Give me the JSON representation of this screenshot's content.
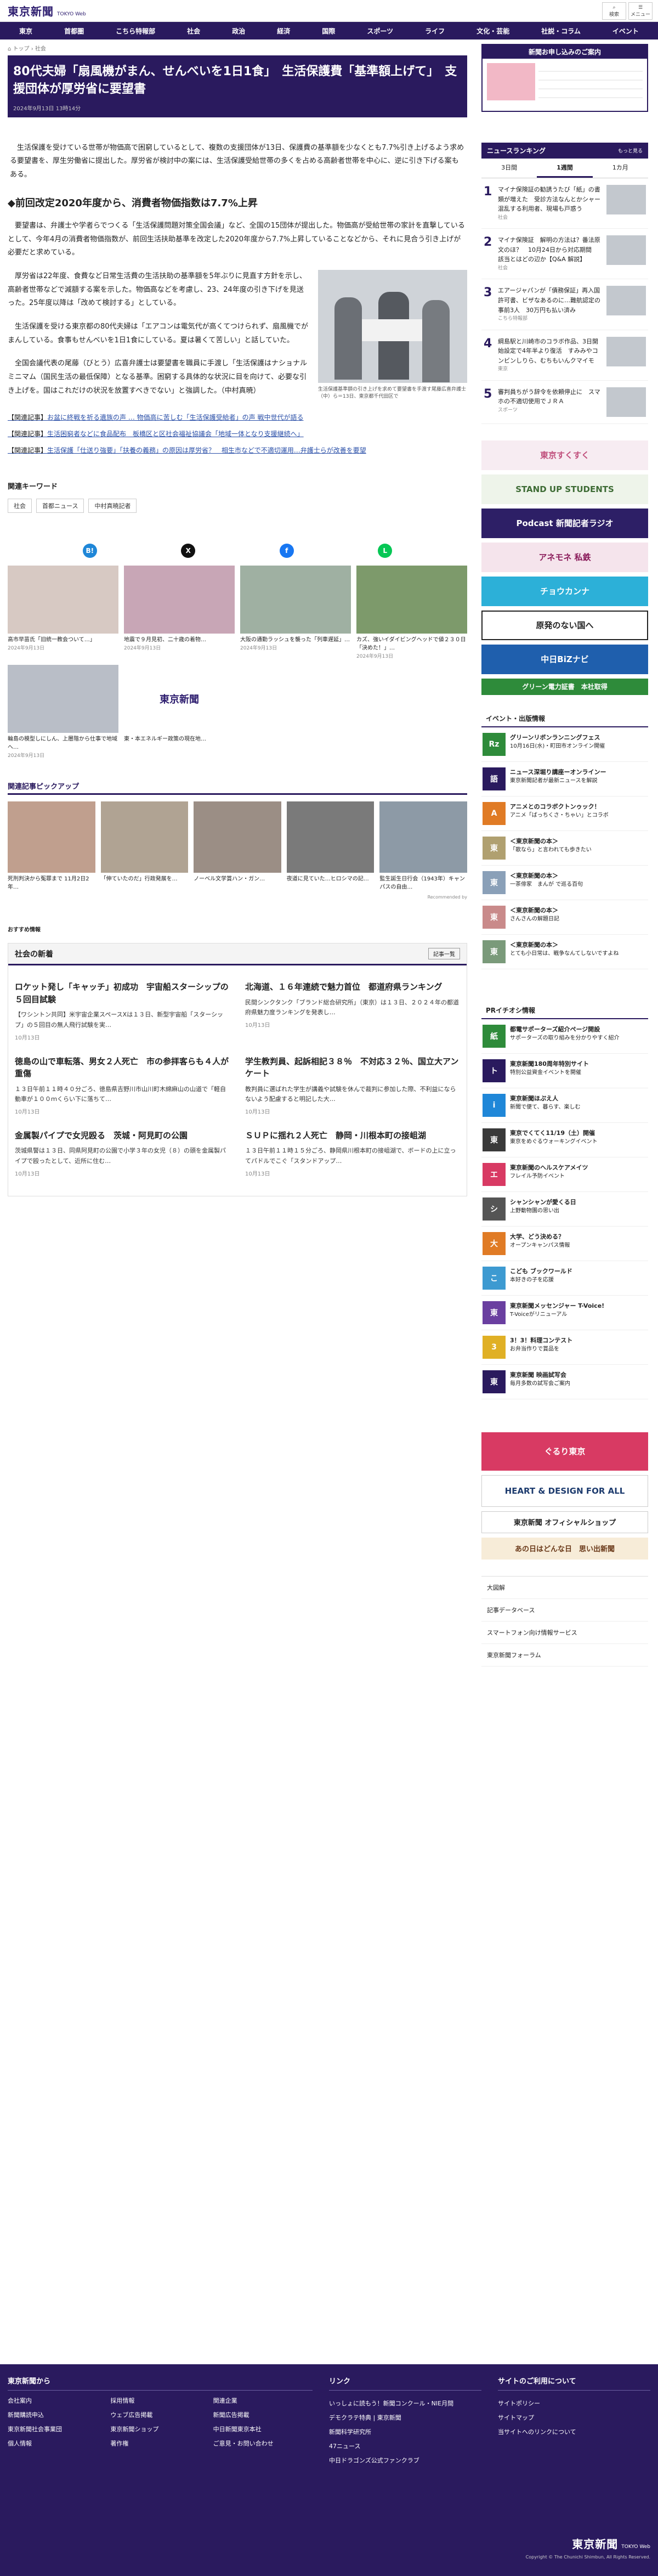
{
  "brand": {
    "jp": "東京新聞",
    "en": "TOKYO Web"
  },
  "top_icons": [
    {
      "label": "検索"
    },
    {
      "label": "メニュー"
    }
  ],
  "nav": [
    "東京",
    "首都圏",
    "こちら特報部",
    "社会",
    "政治",
    "経済",
    "国際",
    "スポーツ",
    "ライフ",
    "文化・芸能",
    "社説・コラム",
    "イベント"
  ],
  "breadcrumb": [
    "トップ",
    "社会"
  ],
  "article": {
    "title": "80代夫婦「扇風機がまん、せんべいを1日1食」　生活保護費「基準額上げて」　支援団体が厚労省に要望書",
    "date": "2024年9月13日 13時14分",
    "lead": "生活保護を受けている世帯が物価高で困窮しているとして、複数の支援団体が13日、保護費の基準額を少なくとも7.7%引き上げるよう求める要望書を、厚生労働省に提出した。厚労省が検討中の案には、生活保護受給世帯の多くを占める高齢者世帯を中心に、逆に引き下げる案もある。",
    "subhead": "◆前回改定2020年度から、消費者物価指数は7.7%上昇",
    "p1": "要望書は、弁護士や学者らでつくる「生活保護問題対策全国会議」など、全国の15団体が提出した。物価高が受給世帯の家計を直撃しているとして、今年4月の消費者物価指数が、前回生活扶助基準を改定した2020年度から7.7%上昇していることなどから、それに見合う引き上げが必要だと求めている。",
    "p2": "厚労省は22年度、食費など日常生活費の生活扶助の基準額を5年ぶりに見直す方針を示し、高齢者世帯などで減額する案を示した。物価高などを考慮し、23、24年度の引き下げを見送った。25年度以降は「改めて検討する」としている。",
    "p3": "生活保護を受ける東京都の80代夫婦は「エアコンは電気代が高くてつけられず、扇風機でがまんしている。食事もせんべいを1日1食にしている。夏は暑くて苦しい」と話していた。",
    "p4": "全国会議代表の尾藤（びとう）広喜弁護士は要望書を職員に手渡し「生活保護はナショナルミニマム（国民生活の最低保障）となる基準。困窮する具体的な状況に目を向けて、必要な引き上げを。国はこれだけの状況を放置すべきでない」と強調した。（中村真暁）",
    "caption": "生活保護基準額の引き上げを求めて要望書を手渡す尾藤広喜弁護士（中）ら＝13日、東京都千代田区で",
    "related": [
      {
        "tag": "【関連記事】",
        "text": "お盆に終戦を祈る遺族の声 … 物価高に苦しむ「生活保護受給者」の声 戦中世代が語る"
      },
      {
        "tag": "【関連記事】",
        "text": "生活困窮者などに食品配布　板橋区と区社会福祉協議会「地域一体となり支援継続へ」"
      },
      {
        "tag": "【関連記事】",
        "text": "生活保護「仕送り強要」「扶養の義務」の原因は厚労省？　相生市などで不適切運用…弁護士らが改善を要望"
      }
    ]
  },
  "keywords": {
    "title": "関連キーワード",
    "items": [
      "社会",
      "首都ニュース",
      "中村真暁記者"
    ]
  },
  "thumbs": [
    {
      "title": "高市早苗氏「旧統一教会ついて…」",
      "date": "2024年9月13日"
    },
    {
      "title": "地震で９月見初、二十歳の着物…",
      "date": "2024年9月13日"
    },
    {
      "title": "大阪の通勤ラッシュを襲った「列車遅延」…",
      "date": "2024年9月13日"
    },
    {
      "title": "カズ、強いイダイビングヘッドで値２３０日「決めた！」…",
      "date": "2024年9月13日"
    },
    {
      "title": "輪島の模型しにしん、上層階から仕事で地域へ…",
      "date": "2024年9月13日"
    },
    {
      "title": "東・本エネルギー政策の現在地…",
      "date": ""
    }
  ],
  "pickup": {
    "title": "関連記事ピックアップ",
    "items": [
      {
        "title": "死刑判決から冤罪まで 11月2日2年…"
      },
      {
        "title": "「伸ていたのだ」行政発展を…"
      },
      {
        "title": "ノーベル文学賞ハン・ガン…"
      },
      {
        "title": "夜道に見ていた…ヒロシマの記…"
      },
      {
        "title": "監生誕生日行会（1943年）キャンパスの自由…"
      }
    ],
    "credit": "Recommended by"
  },
  "recommend": "おすすめ情報",
  "news": {
    "title": "社会の新着",
    "more": "記事一覧",
    "items": [
      {
        "title": "ロケット発し「キャッチ」初成功　宇宙船スターシップの５回目試験",
        "desc": "【ワシントン共同】米宇宙企業スペースXは１３日、新型宇宙船「スターシップ」の５回目の無人飛行試験を実…",
        "date": "10月13日"
      },
      {
        "title": "北海道、１６年連続で魅力首位　都道府県ランキング",
        "desc": "民間シンクタンク「ブランド総合研究所」（東京）は１３日、２０２４年の都道府県魅力度ランキングを発表し…",
        "date": "10月13日"
      },
      {
        "title": "徳島の山で車転落、男女２人死亡　市の参拝客らも４人が重傷",
        "desc": "１３日午前１１時４０分ごろ、徳島県吉野川市山川町木綿麻山の山道で「軽自動車が１００ｍくらい下に落ちて…",
        "date": "10月13日"
      },
      {
        "title": "学生教判員、起訴相記３８％　不対応３２％、国立大アンケート",
        "desc": "教判員に選ばれた学生が講義や試験を休んで裁判に参加した際、不利益にならないよう配慮すると明記した大…",
        "date": "10月13日"
      },
      {
        "title": "金属製パイプで女児殴る　茨城・阿見町の公園",
        "desc": "茨城県警は１３日、同県阿見町の公園で小学３年の女児（８）の頭を金属製パイプで殴ったとして、近所に住む…",
        "date": "10月13日"
      },
      {
        "title": "ＳＵＰに揺れ２人死亡　静岡・川根本町の接岨湖",
        "desc": "１３日午前１１時１５分ごろ、静岡県川根本町の接岨湖で、ボードの上に立ってパドルでこぐ「スタンドアップ…",
        "date": "10月13日"
      }
    ]
  },
  "side": {
    "ad_top": "新聞お申し込みのご案内",
    "ranking": {
      "title": "ニュースランキング",
      "more": "もっと見る",
      "tabs": [
        "3日間",
        "1週間",
        "1カ月"
      ],
      "items": [
        {
          "n": "1",
          "text": "マイナ保険証の勧誘うたび「紙」の書類が増えた　受診方法なんとかシャー　混乱する利用者、現場も戸惑う",
          "cat": "社会"
        },
        {
          "n": "2",
          "text": "マイナ保険証　解明の方法は？番法原文のほ？　10月24日から対応期間　該当とはどの辺か【Q&A 解説】",
          "cat": "社会"
        },
        {
          "n": "3",
          "text": "エアージャパンが「債務保証」再入国許可書、ビザなあるのに…難航認定の事前3人　30万円も払い済み",
          "cat": "こちら特報部"
        },
        {
          "n": "4",
          "text": "綱島駅と川崎市のコラボ作品、3日開始設定で4年半より復活　すみみやコンビンしりら、むちもいんクマイモ",
          "cat": "東京"
        },
        {
          "n": "5",
          "text": "審判員ちがう辞令を依頼停止に　スマホの不適切使用でＪＲＡ",
          "cat": "スポーツ"
        }
      ]
    },
    "banners": [
      {
        "text": "東京すくすく",
        "bg": "#f7ecf2",
        "fg": "#c04f7c"
      },
      {
        "text": "STAND UP STUDENTS",
        "bg": "#eef4ea",
        "fg": "#3d6b34"
      },
      {
        "text": "Podcast 新聞記者ラジオ",
        "bg": "#2d1f66",
        "fg": "#ffffff"
      },
      {
        "text": "アネモネ 私鉄",
        "bg": "#f5e4ec",
        "fg": "#8a1b5a"
      },
      {
        "text": "チョウカンナ",
        "bg": "#2cb0d8",
        "fg": "#ffffff"
      },
      {
        "text": "原発のない国へ",
        "bg": "#ffffff",
        "fg": "#222222"
      },
      {
        "text": "中日BiZナビ",
        "bg": "#1f5fad",
        "fg": "#ffffff"
      },
      {
        "text": "グリーン電力証書　本社取得",
        "bg": "#2e8b3a",
        "fg": "#ffffff"
      }
    ],
    "events": {
      "title": "イベント・出版情報",
      "items": [
        {
          "icon": "Rz",
          "name": "グリーンリボンランニングフェス",
          "desc": "10月16日(水)・町田市オンライン開催"
        },
        {
          "icon": "語",
          "name": "ニュース深堀り講座ーオンラインー",
          "desc": "東京新聞記者が最新ニュースを解説"
        },
        {
          "icon": "A",
          "name": "アニメとのコラボクトンゥック！",
          "desc": "アニメ「ばっちくさ・ちゃい」とコラボ"
        },
        {
          "icon": "東",
          "name": "＜東京新聞の本＞",
          "desc": "「歌なら」と言われても歩きたい"
        },
        {
          "icon": "東",
          "name": "＜東京新聞の本＞",
          "desc": "一茶俳家　まんが で巡る百句"
        },
        {
          "icon": "東",
          "name": "＜東京新聞の本＞",
          "desc": "さんさんの解題日記"
        },
        {
          "icon": "東",
          "name": "＜東京新聞の本＞",
          "desc": "とても小日常は、戦争なんてしないですよね"
        }
      ]
    },
    "pr": {
      "title": "PRイチオシ情報",
      "items": [
        {
          "icon": "紙",
          "name": "都電サポーターズ紹介ページ開設",
          "desc": "サポーターズの取り組みを分かりやすく紹介"
        },
        {
          "icon": "ト",
          "name": "東京新聞180周年特別サイト",
          "desc": "特別公益資金イベントを開催"
        },
        {
          "icon": "i",
          "name": "東京新聞ほぷえ人",
          "desc": "新聞で便て、暮らす、楽しむ"
        },
        {
          "icon": "東",
          "name": "東京でくてく11/19（土）開催",
          "desc": "東京をめぐるウォーキングイベント"
        },
        {
          "icon": "エ",
          "name": "東京新聞のヘルスケアメイツ",
          "desc": "フレイル予防イベント"
        },
        {
          "icon": "シ",
          "name": "シャンシャンが愛くる日",
          "desc": "上野動物園の思い出"
        },
        {
          "icon": "大",
          "name": "大学、どう決める？",
          "desc": "オープンキャンパス情報"
        },
        {
          "icon": "こ",
          "name": "こども ブックワールド",
          "desc": "本好きの子を応援"
        },
        {
          "icon": "東",
          "name": "東京新聞メッセンジャー T-Voice!",
          "desc": "T-Voiceがリニューアル"
        },
        {
          "icon": "3",
          "name": "3！3！料理コンテスト",
          "desc": "お弁当作りで賞品を"
        },
        {
          "icon": "東",
          "name": "東京新聞 映画試写会",
          "desc": "毎月多数の試写会ご案内"
        }
      ]
    },
    "banners2": [
      {
        "text": "ぐるり東京",
        "bg": "#d83a63",
        "fg": "#ffffff"
      },
      {
        "text": "HEART & DESIGN FOR ALL",
        "bg": "#ffffff",
        "fg": "#1d3b6e"
      },
      {
        "text": "東京新聞 オフィシャルショップ",
        "bg": "#ffffff",
        "fg": "#222222"
      },
      {
        "text": "あの日はどんな日　思い出新聞",
        "bg": "#f7ecd8",
        "fg": "#6b3a1a"
      }
    ],
    "menu": [
      "大図解",
      "記事データベース",
      "スマートフォン向け情報サービス",
      "東京新聞フォーラム"
    ]
  },
  "footer": {
    "col1": {
      "title": "東京新聞から",
      "items": [
        "会社案内",
        "採用情報",
        "関連企業",
        "新聞購読申込",
        "ウェブ広告掲載",
        "新聞広告掲載",
        "東京新聞社会事業団",
        "東京新聞ショップ",
        "中日新聞東京本社",
        "個人情報",
        "著作権",
        "ご意見・お問い合わせ"
      ]
    },
    "col2": {
      "title": "リンク",
      "items": [
        "いっしょに読もう！新聞コンクール・NIE月間",
        "デモクラテ特典 | 東京新聞",
        "新聞科学研究所",
        "47ニュース",
        "中日ドラゴンズ公式ファンクラブ"
      ]
    },
    "col3": {
      "title": "サイトのご利用について",
      "items": [
        "サイトポリシー",
        "サイトマップ",
        "当サイトへのリンクについて"
      ]
    },
    "copyright": "Copyright © The Chunichi Shimbun, All Rights Reserved."
  }
}
